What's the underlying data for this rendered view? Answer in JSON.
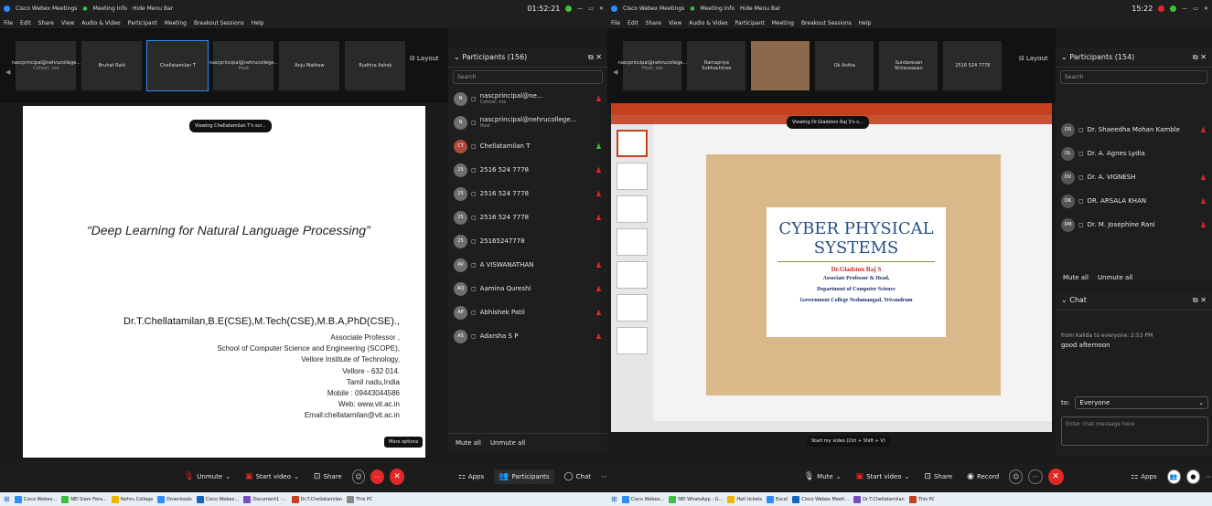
{
  "left": {
    "titlebar": {
      "app": "Cisco Webex Meetings",
      "meeting_info": "Meeting Info",
      "hide_menu": "Hide Menu Bar",
      "clock": "01:52:21"
    },
    "menu": [
      "File",
      "Edit",
      "Share",
      "View",
      "Audio & Video",
      "Participant",
      "Meeting",
      "Breakout Sessions",
      "Help"
    ],
    "layout_label": "Layout",
    "tiles": [
      {
        "name": "nascprincipal@nehrucollege...",
        "sub": "Cohost, me"
      },
      {
        "name": "Bruhat Rahi",
        "sub": ""
      },
      {
        "name": "Chellatamilan T",
        "sub": ""
      },
      {
        "name": "nascprincipal@nehrucollege...",
        "sub": "Host"
      },
      {
        "name": "Anju Mathew",
        "sub": ""
      },
      {
        "name": "Rudhira Ashok",
        "sub": ""
      }
    ],
    "viewing_tooltip": "Viewing Chellatamilan T's scr...",
    "slide": {
      "title": "“Deep Learning for Natural Language Processing”",
      "author": "Dr.T.Chellatamilan,B.E(CSE),M.Tech(CSE),M.B.A,PhD(CSE).,",
      "lines": [
        "Associate Professor ,",
        "School of Computer Science and Engineering (SCOPE),",
        "Vellore Institute of Technology,",
        "Vellore - 632 014.",
        "Tamil nadu,India",
        "Mobile : 09443044586",
        "Web:  www.vit.ac.in",
        "Email:chellatamilan@vit.ac.in"
      ]
    },
    "more_options_hint": "More options",
    "participants": {
      "header": "Participants (156)",
      "search_placeholder": "Search",
      "rows": [
        {
          "initials": "N",
          "name": "nascprincipal@ne...",
          "sub": "Cohost, me",
          "avatar": "#6e6e6e",
          "mic": "muted"
        },
        {
          "initials": "N",
          "name": "nascprincipal@nehrucollege...",
          "sub": "Host",
          "avatar": "#6e6e6e",
          "mic": "none"
        },
        {
          "initials": "CT",
          "name": "Chellatamilan T",
          "sub": "",
          "avatar": "#b04a3a",
          "mic": "on"
        },
        {
          "initials": "25",
          "name": "2516 524 7778",
          "sub": "",
          "avatar": "#6e6e6e",
          "mic": "muted"
        },
        {
          "initials": "25",
          "name": "2516 524 7778",
          "sub": "",
          "avatar": "#6e6e6e",
          "mic": "muted"
        },
        {
          "initials": "25",
          "name": "2516 524 7778",
          "sub": "",
          "avatar": "#6e6e6e",
          "mic": "muted"
        },
        {
          "initials": "25",
          "name": "25165247778",
          "sub": "",
          "avatar": "#6e6e6e",
          "mic": "none"
        },
        {
          "initials": "AV",
          "name": "A VISWANATHAN",
          "sub": "",
          "avatar": "#6e6e6e",
          "mic": "muted"
        },
        {
          "initials": "AQ",
          "name": "Aamina Qureshi",
          "sub": "",
          "avatar": "#6e6e6e",
          "mic": "muted"
        },
        {
          "initials": "AP",
          "name": "Abhishek Patil",
          "sub": "",
          "avatar": "#6e6e6e",
          "mic": "muted"
        },
        {
          "initials": "AS",
          "name": "Adarsha S P",
          "sub": "",
          "avatar": "#6e6e6e",
          "mic": "muted"
        }
      ],
      "mute_all": "Mute all",
      "unmute_all": "Unmute all"
    },
    "toolbar": {
      "unmute": "Unmute",
      "start_video": "Start video",
      "share": "Share",
      "apps": "Apps",
      "participants": "Participants",
      "chat": "Chat"
    },
    "taskbar": [
      "Cisco Webex...",
      "NEI Siam Fera...",
      "Nehru College",
      "Downloads",
      "Cisco Webex...",
      "Document1 -...",
      "Dr.T.Chellatamilan",
      "This PC"
    ]
  },
  "right": {
    "titlebar": {
      "app": "Cisco Webex Meetings",
      "meeting_info": "Meeting Info",
      "hide_menu": "Hide Menu Bar",
      "clock": "15:22"
    },
    "menu": [
      "File",
      "Edit",
      "Share",
      "View",
      "Audio & Video",
      "Participant",
      "Meeting",
      "Breakout Sessions",
      "Help"
    ],
    "layout_label": "Layout",
    "tiles": [
      {
        "name": "nascprincipal@nehrucollege...",
        "sub": "Host, me"
      },
      {
        "name": "Ramapriya Subhashinee",
        "sub": ""
      },
      {
        "name": "",
        "sub": ""
      },
      {
        "name": "Ok Antha",
        "sub": ""
      },
      {
        "name": "Sundaresan Shiravaasan",
        "sub": ""
      },
      {
        "name": "2516 524 7778",
        "sub": ""
      }
    ],
    "viewing_tooltip": "Viewing Dr.Gladston Raj S's s...",
    "ppt": {
      "title": "CYBER PHYSICAL",
      "title2": "SYSTEMS",
      "author": "Dr.Gladston Raj S",
      "lines": [
        "Associate Professor & Head,",
        "Department of Computer Science",
        "Government College Nedumangad, Trivandrum"
      ]
    },
    "start_video_hint": "Start my video (Ctrl + Shift + V)",
    "participants": {
      "header": "Participants (154)",
      "search_placeholder": "Search",
      "rows": [
        {
          "initials": "DS",
          "name": "Dr. Shaeedha Mohan Kamble",
          "mic": "muted"
        },
        {
          "initials": "DL",
          "name": "Dr. A. Agnes Lydia",
          "mic": "none"
        },
        {
          "initials": "DV",
          "name": "Dr. A. VIGNESH",
          "mic": "muted"
        },
        {
          "initials": "DK",
          "name": "DR. ARSALA KHAN",
          "mic": "muted"
        },
        {
          "initials": "DM",
          "name": "Dr. M. Josephine Rani",
          "mic": "muted"
        }
      ],
      "mute_all": "Mute all",
      "unmute_all": "Unmute all"
    },
    "chat": {
      "header": "Chat",
      "from": "from Kalida to everyone:  2:53 PM",
      "message": "good afternoon",
      "to_label": "to:",
      "to_value": "Everyone",
      "placeholder": "Enter chat message here"
    },
    "toolbar": {
      "mute": "Mute",
      "start_video": "Start video",
      "share": "Share",
      "record": "Record",
      "apps": "Apps"
    },
    "taskbar": [
      "Cisco Webex...",
      "NEI WhatsApp - G...",
      "Hall tickets",
      "Excel",
      "Cisco Webex Meeti...",
      "Dr.T.Chellatamilan",
      "This PC"
    ]
  }
}
